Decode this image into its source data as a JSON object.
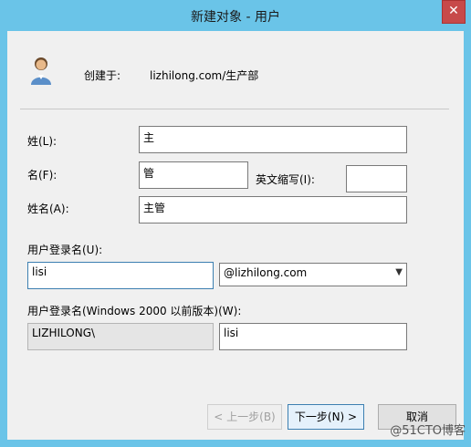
{
  "window": {
    "title": "新建对象 - 用户",
    "close_label": "✕"
  },
  "header": {
    "created_in_label": "创建于:",
    "created_in_path": "lizhilong.com/生产部",
    "icon": "user-icon"
  },
  "form": {
    "last_name": {
      "label": "姓(L):",
      "value": "主"
    },
    "first_name": {
      "label": "名(F):",
      "value": "管"
    },
    "initials": {
      "label": "英文缩写(I):",
      "value": ""
    },
    "full_name": {
      "label": "姓名(A):",
      "value": "主管"
    },
    "logon_name": {
      "label": "用户登录名(U):",
      "value": "lisi"
    },
    "domain": {
      "selected": "@lizhilong.com"
    },
    "pre2000_label": "用户登录名(Windows 2000 以前版本)(W):",
    "pre2000_domain": "LIZHILONG\\",
    "pre2000_name": "lisi"
  },
  "buttons": {
    "back": "< 上一步(B)",
    "next": "下一步(N) >",
    "cancel": "取消"
  },
  "watermark": "@51CTO博客"
}
